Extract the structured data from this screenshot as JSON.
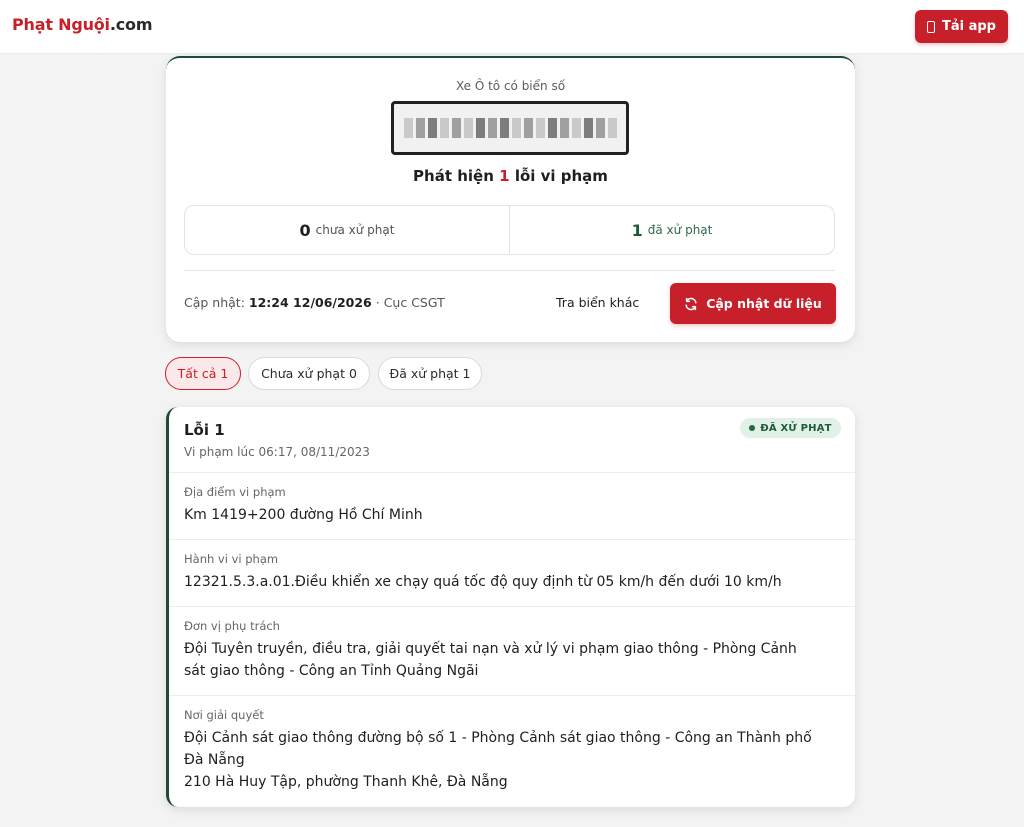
{
  "header": {
    "logo_brand": "Phạt Nguội",
    "logo_tld": ".com",
    "app_button": "Tải app",
    "app_icon": "phone-icon"
  },
  "summary": {
    "vehicle_label": "Xe Ô tô có biển số",
    "detect_prefix": "Phát hiện",
    "detect_count": "1",
    "detect_suffix": "lỗi vi phạm",
    "unpaid_count": "0",
    "unpaid_label": "chưa xử phạt",
    "paid_count": "1",
    "paid_label": "đã xử phạt",
    "updated_label": "Cập nhật:",
    "updated_time": "12:24 12/06/2026",
    "updated_source": "· Cục CSGT",
    "other_plate_link": "Tra biển khác",
    "refresh_button": "Cập nhật dữ liệu",
    "refresh_icon": "refresh-icon"
  },
  "filters": [
    {
      "label": "Tất cả 1",
      "active": true
    },
    {
      "label": "Chưa xử phạt 0",
      "active": false
    },
    {
      "label": "Đã xử phạt 1",
      "active": false
    }
  ],
  "violation": {
    "title": "Lỗi 1",
    "time": "Vi phạm lúc 06:17, 08/11/2023",
    "status": "ĐÃ XỬ PHẠT",
    "status_color": "#1f5a3a",
    "sections": [
      {
        "label": "Địa điểm vi phạm",
        "lines": [
          "Km 1419+200 đường Hồ Chí Minh"
        ]
      },
      {
        "label": "Hành vi vi phạm",
        "lines": [
          "12321.5.3.a.01.Điều khiển xe chạy quá tốc độ quy định từ 05 km/h đến dưới 10 km/h"
        ]
      },
      {
        "label": "Đơn vị phụ trách",
        "lines": [
          "Đội Tuyên truyền, điều tra, giải quyết tai nạn và xử lý vi phạm giao thông - Phòng Cảnh",
          "sát giao thông - Công an Tỉnh Quảng Ngãi"
        ]
      },
      {
        "label": "Nơi giải quyết",
        "lines": [
          "Đội Cảnh sát giao thông đường bộ số 1 - Phòng Cảnh sát giao thông - Công an Thành phố",
          "Đà Nẵng",
          "210 Hà Huy Tập, phường Thanh Khê, Đà Nẵng"
        ]
      }
    ]
  },
  "colors": {
    "accent": "#c8202a",
    "success": "#1f5a3a",
    "page_bg": "#f3f3f3"
  }
}
